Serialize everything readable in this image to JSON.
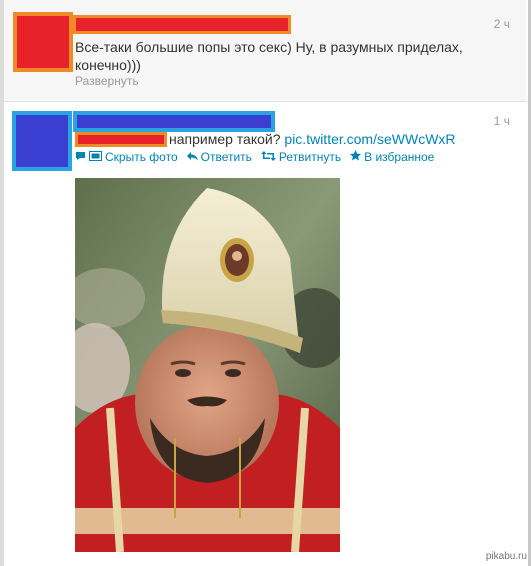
{
  "tweets": [
    {
      "time": "2 ч",
      "text": "Все-таки большие попы это секс) Ну, в разумных приделах, конечно)))",
      "expand_label": "Развернуть"
    },
    {
      "time": "1 ч",
      "text": "например такой?",
      "link": "pic.twitter.com/seWWcWxR",
      "actions": {
        "hide_photo": "Скрыть фото",
        "reply": "Ответить",
        "retweet": "Ретвитнуть",
        "favorite": "В избранное"
      }
    }
  ],
  "watermark": "pikabu.ru",
  "colors": {
    "redaction_red": "#e8222b",
    "redaction_orange": "#f08a26",
    "redaction_blue": "#3b3fd1",
    "redaction_cyan": "#2aa3e3",
    "link": "#0084b4"
  },
  "icons": {
    "reply": "reply-arrow-icon",
    "retweet": "retweet-icon",
    "favorite": "star-icon",
    "photo": "photo-icon",
    "comment": "speech-bubble-icon"
  }
}
